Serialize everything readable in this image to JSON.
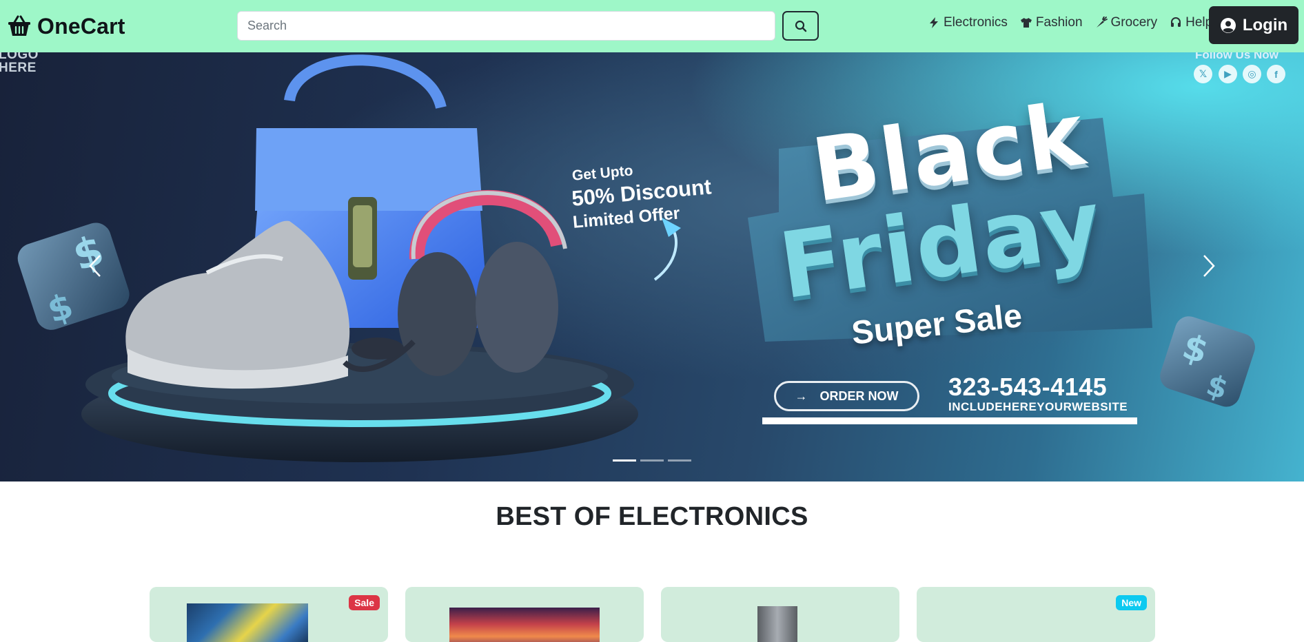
{
  "navbar": {
    "brand": "OneCart",
    "search_placeholder": "Search",
    "links": [
      {
        "label": "Electronics",
        "icon": "bolt-icon"
      },
      {
        "label": "Fashion",
        "icon": "shirt-icon"
      },
      {
        "label": "Grocery",
        "icon": "carrot-icon"
      },
      {
        "label": "Help",
        "icon": "headset-icon"
      }
    ],
    "login_label": "Login",
    "bg_color": "#9ef7c8"
  },
  "hero": {
    "logo_here": [
      "LOGO",
      "HERE"
    ],
    "follow_text": "Follow Us Now",
    "social_icons": [
      "x-icon",
      "youtube-icon",
      "instagram-icon",
      "facebook-icon"
    ],
    "offer_line1": "Get Upto",
    "offer_line2": "50% Discount",
    "offer_line3": "Limited Offer",
    "headline_1": "Black",
    "headline_2": "Friday",
    "headline_3": "Super Sale",
    "order_button": "ORDER NOW",
    "phone": "323-543-4145",
    "website": "INCLUDEHEREYOURWEBSITE",
    "slide_count": 3,
    "active_slide": 0
  },
  "section": {
    "title": "BEST OF ELECTRONICS"
  },
  "products": [
    {
      "badge": "Sale",
      "badge_color": "#dc3545"
    },
    {
      "badge": "",
      "badge_color": ""
    },
    {
      "badge": "",
      "badge_color": ""
    },
    {
      "badge": "New",
      "badge_color": "#0dcaf0"
    }
  ]
}
